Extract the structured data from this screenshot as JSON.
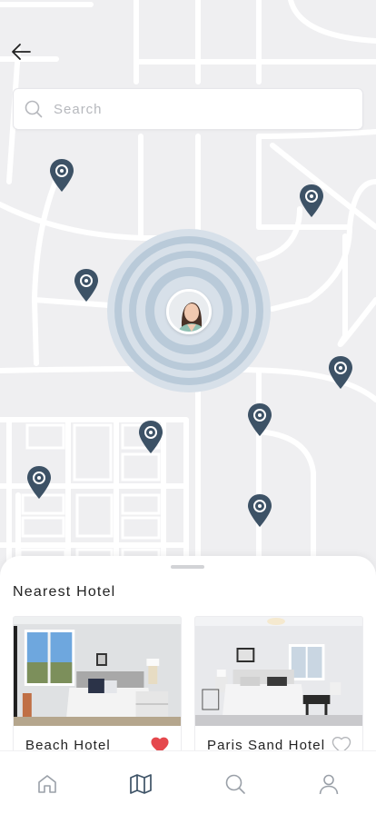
{
  "header": {
    "back_icon": "arrow-left-icon"
  },
  "search": {
    "placeholder": "Search",
    "icon": "search-icon"
  },
  "map": {
    "pin_icon": "map-pin-icon",
    "pin_color": "#3d5266",
    "pulse_color": "#b8cad9",
    "road_color": "#ffffff",
    "land_color": "#efeff1"
  },
  "nearest": {
    "title": "Nearest Hotel",
    "hotels": [
      {
        "name": "Beach Hotel",
        "favorite": true
      },
      {
        "name": "Paris Sand Hotel",
        "favorite": false
      }
    ],
    "favorite_color": "#e5484d"
  },
  "tabbar": {
    "items": [
      {
        "icon": "home-icon",
        "active": false
      },
      {
        "icon": "map-icon",
        "active": true
      },
      {
        "icon": "search-icon",
        "active": false
      },
      {
        "icon": "profile-icon",
        "active": false
      }
    ],
    "active_color": "#3d5266",
    "inactive_color": "#9aa0a8"
  }
}
